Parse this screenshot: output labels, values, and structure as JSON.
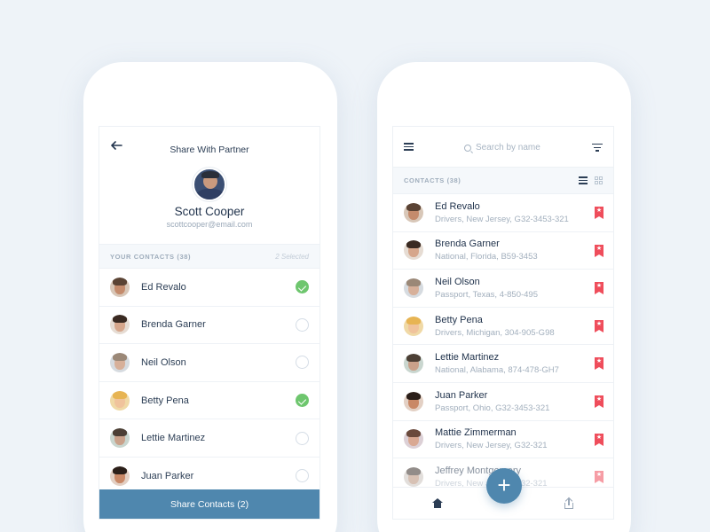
{
  "left": {
    "title": "Share With Partner",
    "profile": {
      "name": "Scott Cooper",
      "email": "scottcooper@email.com"
    },
    "section_label": "YOUR CONTACTS (38)",
    "selected_label": "2 Selected",
    "contacts": [
      {
        "name": "Ed Revalo",
        "checked": true
      },
      {
        "name": "Brenda Garner",
        "checked": false
      },
      {
        "name": "Neil Olson",
        "checked": false
      },
      {
        "name": "Betty Pena",
        "checked": true
      },
      {
        "name": "Lettie Martinez",
        "checked": false
      },
      {
        "name": "Juan Parker",
        "checked": false
      }
    ],
    "share_button": "Share Contacts (2)"
  },
  "right": {
    "search_placeholder": "Search by name",
    "section_label": "CONTACTS (38)",
    "contacts": [
      {
        "name": "Ed Revalo",
        "detail": "Drivers, New Jersey, G32-3453-321"
      },
      {
        "name": "Brenda Garner",
        "detail": "National, Florida, B59-3453"
      },
      {
        "name": "Neil Olson",
        "detail": "Passport, Texas, 4-850-495"
      },
      {
        "name": "Betty Pena",
        "detail": "Drivers, Michigan, 304-905-G98"
      },
      {
        "name": "Lettie Martinez",
        "detail": "National, Alabama, 874-478-GH7"
      },
      {
        "name": "Juan Parker",
        "detail": "Passport, Ohio, G32-3453-321"
      },
      {
        "name": "Mattie Zimmerman",
        "detail": "Drivers, New Jersey, G32-321"
      },
      {
        "name": "Jeffrey Montgomery",
        "detail": "Drivers, New Jersey, G32-321"
      }
    ],
    "fab_label": "+"
  },
  "colors": {
    "background": "#eef3f8",
    "accent": "#4f87ae",
    "check": "#6ec66e",
    "bookmark": "#ef4d5b"
  }
}
